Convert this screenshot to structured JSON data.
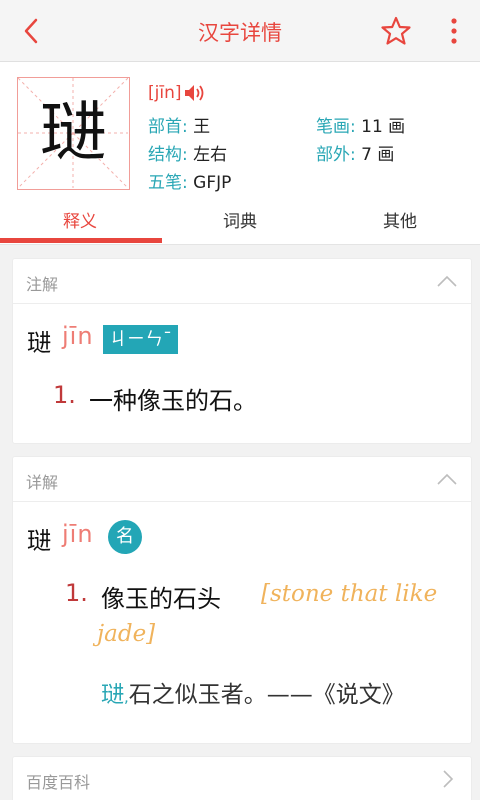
{
  "topbar": {
    "title": "汉字详情",
    "back_icon": "back-arrow-icon",
    "favorite_icon": "star-icon",
    "more_icon": "more-vert-icon",
    "accent_color": "#e8463e"
  },
  "char": {
    "character": "琎",
    "pinyin": "[jīn]",
    "radical_label": "部首:",
    "radical_value": "王",
    "strokes_label": "笔画:",
    "strokes_value": "11 画",
    "structure_label": "结构:",
    "structure_value": "左右",
    "outside_label": "部外:",
    "outside_value": "7 画",
    "wubi_label": "五笔:",
    "wubi_value": "GFJP"
  },
  "tabs": {
    "items": [
      "释义",
      "词典",
      "其他"
    ],
    "active_index": 0
  },
  "note_card": {
    "title": "注解",
    "headword": "琎",
    "pinyin": "jīn",
    "zhuyin": "ㄐㄧㄣˉ",
    "definitions": [
      {
        "num": "1.",
        "text": "一种像玉的石。"
      }
    ]
  },
  "detail_card": {
    "title": "详解",
    "headword": "琎",
    "pinyin": "jīn",
    "pos": "名",
    "definitions": [
      {
        "num": "1.",
        "text": "像玉的石头",
        "english_line1": "[stone that like",
        "english_line2": "jade]"
      }
    ],
    "example_head": "琎",
    "example_mark": ",",
    "example_text": "石之似玉者。——《说文》"
  },
  "baike_card": {
    "title": "百度百科"
  }
}
